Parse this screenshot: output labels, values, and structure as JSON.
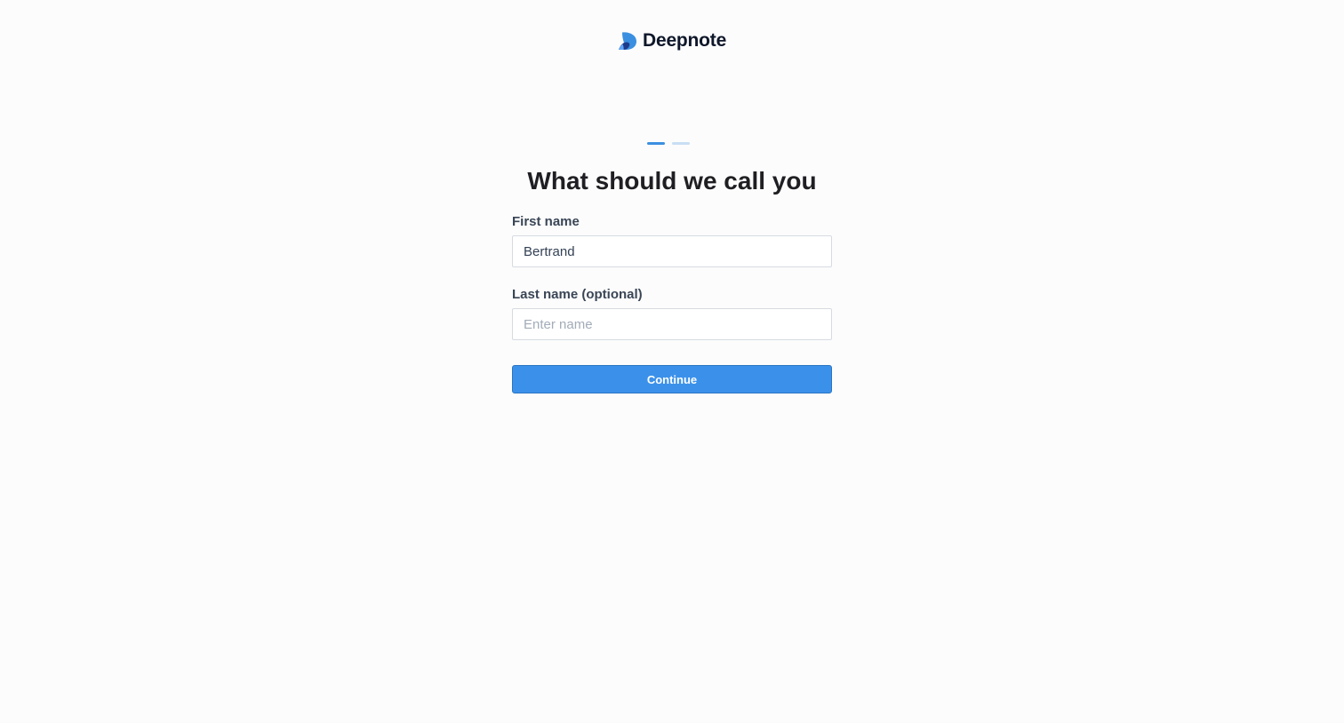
{
  "brand": {
    "name": "Deepnote",
    "logo_icon": "deepnote-logo-icon",
    "accent_color": "#3b91ea"
  },
  "progress": {
    "total_steps": 2,
    "current_step": 1
  },
  "heading": "What should we call you",
  "form": {
    "first_name": {
      "label": "First name",
      "value": "Bertrand",
      "placeholder": ""
    },
    "last_name": {
      "label": "Last name (optional)",
      "value": "",
      "placeholder": "Enter name"
    },
    "continue_label": "Continue"
  }
}
